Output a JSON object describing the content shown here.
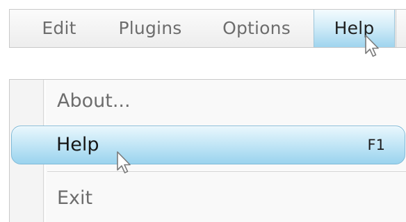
{
  "menubar": {
    "items": [
      {
        "label": "Edit"
      },
      {
        "label": "Plugins"
      },
      {
        "label": "Options"
      },
      {
        "label": "Help",
        "active": true
      }
    ]
  },
  "dropdown": {
    "items": [
      {
        "label": "About..."
      },
      {
        "label": "Help",
        "shortcut": "F1",
        "highlighted": true
      },
      {
        "label": "Exit"
      }
    ]
  },
  "colors": {
    "highlight": "#c3e6f6",
    "highlight_border": "#7fbad8",
    "text_muted": "#6d6d6d",
    "text_active": "#151515"
  },
  "icons": {
    "cursor": "arrow-cursor-icon"
  }
}
